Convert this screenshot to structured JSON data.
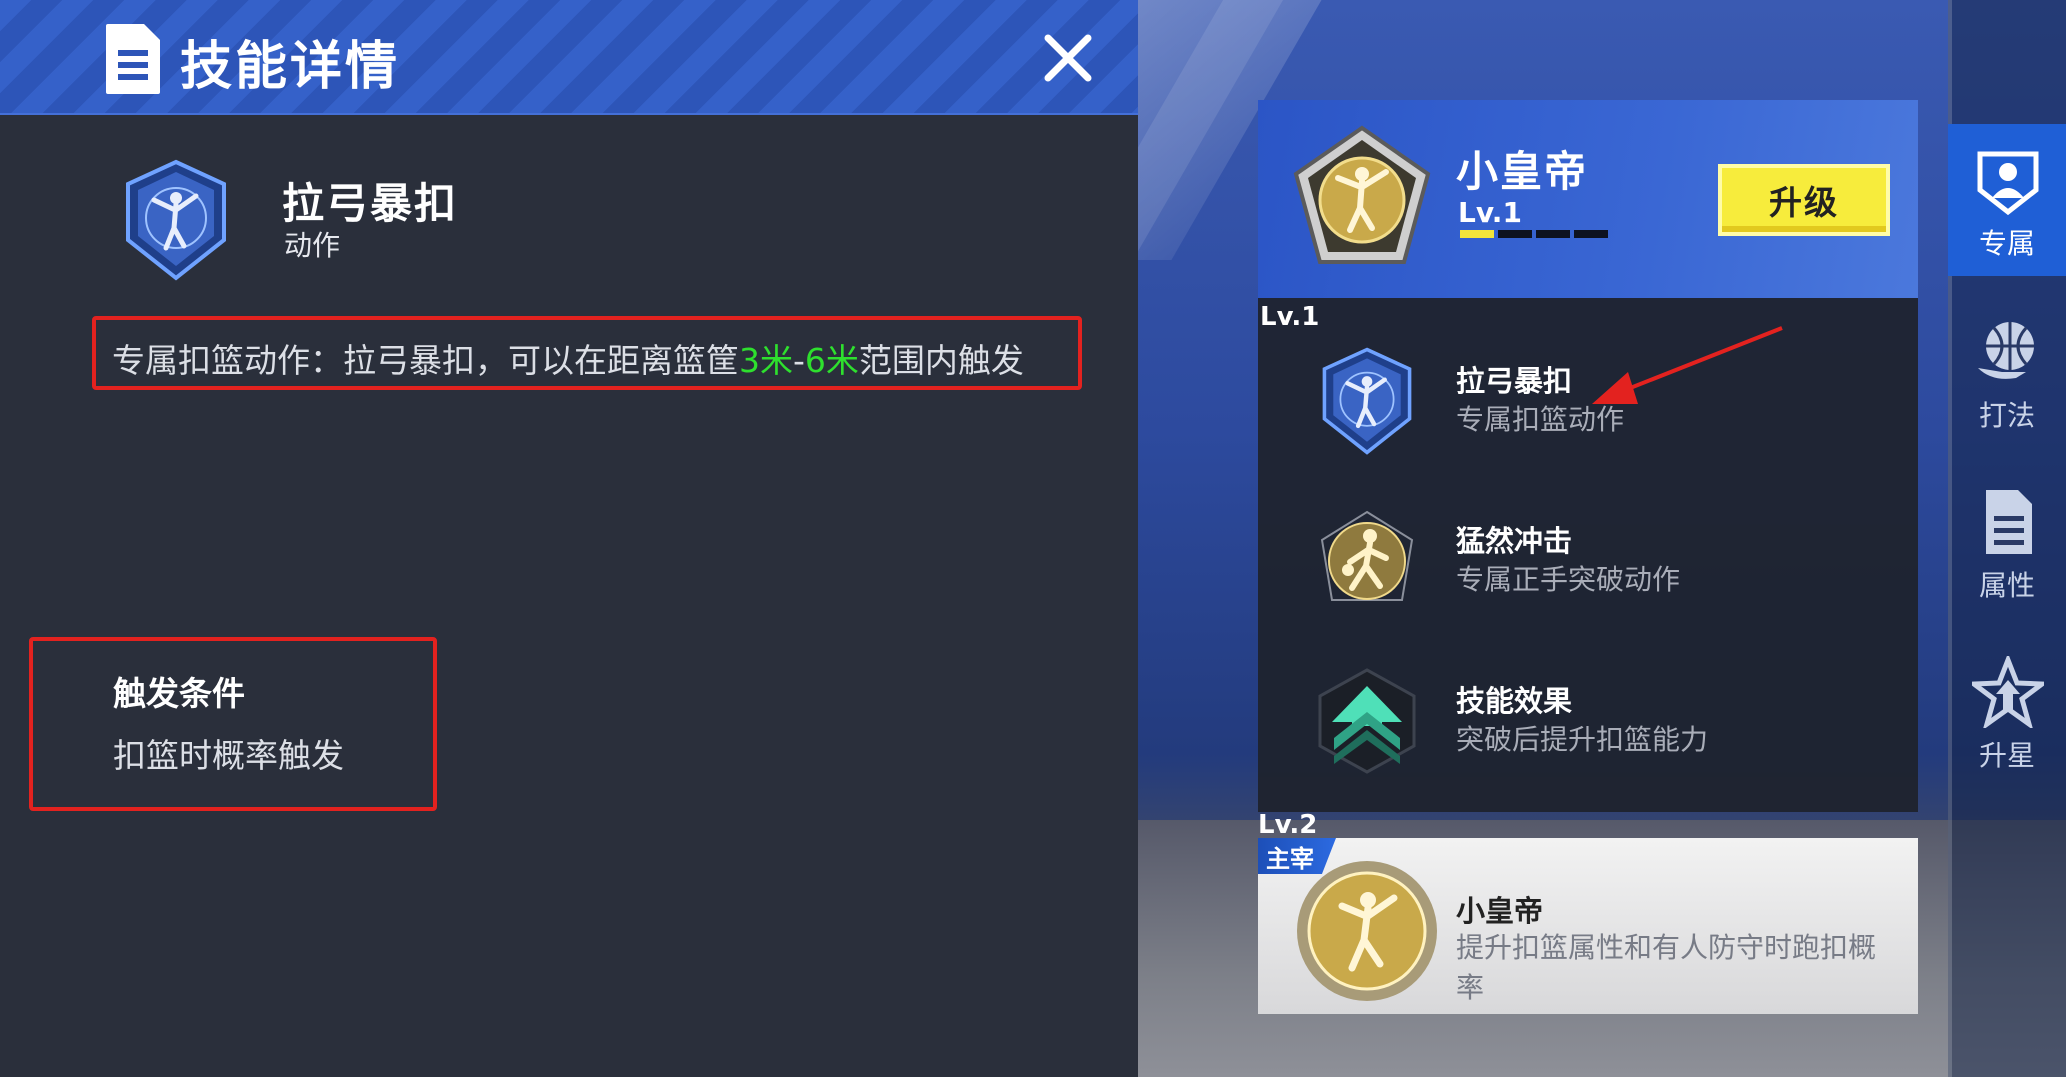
{
  "dialog": {
    "title": "技能详情",
    "skill": {
      "name": "拉弓暴扣",
      "type": "动作"
    },
    "description": {
      "prefix": "专属扣篮动作：拉弓暴扣，可以在距离篮筐",
      "range_min": "3米",
      "range_sep": "-",
      "range_max": "6米",
      "suffix": "范围内触发"
    },
    "trigger": {
      "title": "触发条件",
      "text": "扣篮时概率触发"
    }
  },
  "panel": {
    "character": {
      "name": "小皇帝",
      "level": "Lv.1",
      "level_progress": 0.25
    },
    "upgrade_label": "升级",
    "lv1": {
      "label": "Lv.1",
      "items": [
        {
          "name": "拉弓暴扣",
          "desc": "专属扣篮动作",
          "icon": "dunk-badge-icon"
        },
        {
          "name": "猛然冲击",
          "desc": "专属正手突破动作",
          "icon": "dribble-player-icon"
        },
        {
          "name": "技能效果",
          "desc": "突破后提升扣篮能力",
          "icon": "upgrade-arrow-icon"
        }
      ]
    },
    "lv2": {
      "label": "Lv.2",
      "tag": "主宰",
      "name": "小皇帝",
      "desc": "提升扣篮属性和有人防守时跑扣概率"
    }
  },
  "tabs": [
    {
      "label": "专属",
      "icon": "exclusive-player-icon",
      "active": true
    },
    {
      "label": "打法",
      "icon": "basketball-hand-icon",
      "active": false
    },
    {
      "label": "属性",
      "icon": "document-icon",
      "active": false
    },
    {
      "label": "升星",
      "icon": "star-up-icon",
      "active": false
    }
  ],
  "colors": {
    "highlight": "#2ee02e",
    "annotation": "#e3221f",
    "upgrade_button": "#f7ec3c",
    "active_tab": "#1f5fd6"
  }
}
